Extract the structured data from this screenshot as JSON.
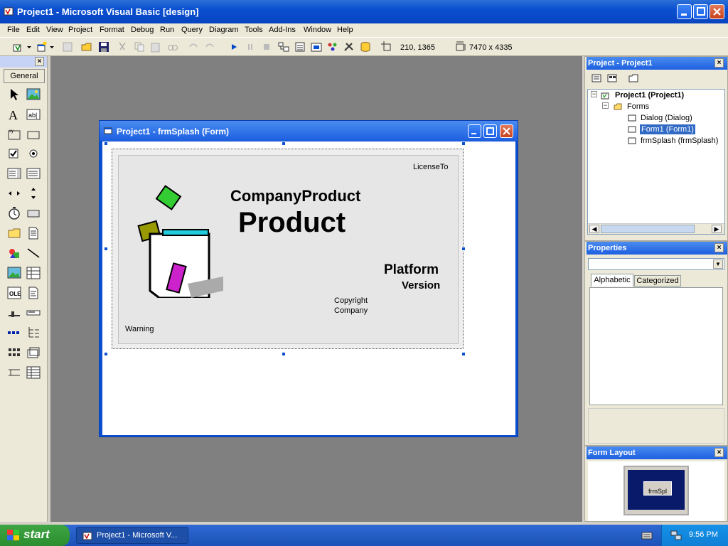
{
  "window": {
    "title": "Project1 - Microsoft Visual Basic [design]"
  },
  "menu": [
    "File",
    "Edit",
    "View",
    "Project",
    "Format",
    "Debug",
    "Run",
    "Query",
    "Diagram",
    "Tools",
    "Add-Ins",
    "Window",
    "Help"
  ],
  "toolbar": {
    "position": "210, 1365",
    "size": "7470 x 4335"
  },
  "toolbox": {
    "tab": "General"
  },
  "form_window": {
    "title": "Project1 - frmSplash (Form)"
  },
  "splash": {
    "license_to": "LicenseTo",
    "company_product": "CompanyProduct",
    "product": "Product",
    "platform": "Platform",
    "version": "Version",
    "copyright": "Copyright",
    "company": "Company",
    "warning": "Warning"
  },
  "project_panel": {
    "title": "Project - Project1",
    "root": "Project1 (Project1)",
    "folder": "Forms",
    "items": [
      "Dialog (Dialog)",
      "Form1 (Form1)",
      "frmSplash (frmSplash)"
    ],
    "selected": "Form1 (Form1)"
  },
  "properties_panel": {
    "title": "Properties",
    "tabs": [
      "Alphabetic",
      "Categorized"
    ]
  },
  "layout_panel": {
    "title": "Form Layout",
    "preview_label": "frmSpl"
  },
  "taskbar": {
    "start": "start",
    "task": "Project1 - Microsoft V...",
    "clock": "9:56 PM"
  }
}
